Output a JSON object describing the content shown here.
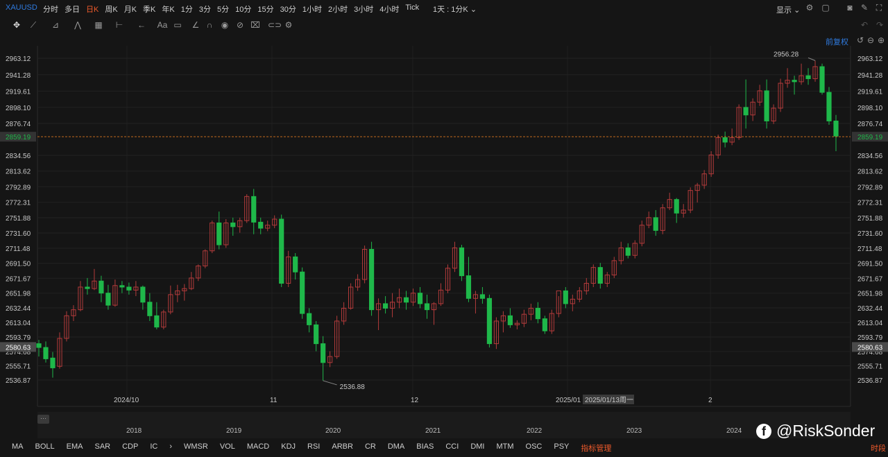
{
  "toolbar": {
    "symbol": "XAUUSD",
    "periods": [
      "分时",
      "多日",
      "日K",
      "周K",
      "月K",
      "季K",
      "年K",
      "1分",
      "3分",
      "5分",
      "10分",
      "15分",
      "30分",
      "1小时",
      "2小时",
      "3小时",
      "4小时",
      "Tick"
    ],
    "active_period": "日K",
    "timeframe_select": "1天 : 1分K",
    "display_label": "显示"
  },
  "adjust_label": "前复权",
  "chart_data": {
    "type": "candlestick",
    "y_ticks": [
      "2963.12",
      "2941.28",
      "2919.61",
      "2898.10",
      "2876.74",
      "2834.56",
      "2813.62",
      "2792.89",
      "2772.31",
      "2751.88",
      "2731.60",
      "2711.48",
      "2691.50",
      "2671.67",
      "2651.98",
      "2632.44",
      "2613.04",
      "2593.79",
      "2574.68",
      "2555.71",
      "2536.87"
    ],
    "ylim": [
      2527,
      2972
    ],
    "x_labels": [
      "2024/10",
      "11",
      "12",
      "2025/01",
      "2"
    ],
    "crosshair_date": "2025/01/13周一",
    "current_price": "2859.19",
    "left_marker_price": "2580.63",
    "high_label": "2956.28",
    "low_label": "2536.88",
    "candles": [
      [
        2585,
        2590,
        2568,
        2580
      ],
      [
        2580,
        2588,
        2560,
        2565
      ],
      [
        2566,
        2574,
        2540,
        2553
      ],
      [
        2555,
        2600,
        2552,
        2592
      ],
      [
        2592,
        2628,
        2588,
        2622
      ],
      [
        2622,
        2636,
        2615,
        2630
      ],
      [
        2630,
        2668,
        2628,
        2660
      ],
      [
        2660,
        2672,
        2650,
        2658
      ],
      [
        2658,
        2684,
        2656,
        2668
      ],
      [
        2668,
        2675,
        2640,
        2652
      ],
      [
        2652,
        2663,
        2630,
        2636
      ],
      [
        2636,
        2670,
        2634,
        2662
      ],
      [
        2662,
        2668,
        2652,
        2660
      ],
      [
        2660,
        2666,
        2650,
        2656
      ],
      [
        2656,
        2668,
        2648,
        2660
      ],
      [
        2660,
        2662,
        2630,
        2640
      ],
      [
        2640,
        2652,
        2615,
        2622
      ],
      [
        2622,
        2640,
        2604,
        2607
      ],
      [
        2607,
        2630,
        2604,
        2627
      ],
      [
        2627,
        2662,
        2624,
        2650
      ],
      [
        2650,
        2663,
        2640,
        2655
      ],
      [
        2655,
        2664,
        2642,
        2658
      ],
      [
        2658,
        2680,
        2656,
        2672
      ],
      [
        2672,
        2690,
        2668,
        2688
      ],
      [
        2688,
        2710,
        2685,
        2708
      ],
      [
        2708,
        2748,
        2705,
        2745
      ],
      [
        2745,
        2760,
        2710,
        2716
      ],
      [
        2716,
        2750,
        2712,
        2745
      ],
      [
        2745,
        2752,
        2728,
        2740
      ],
      [
        2740,
        2752,
        2732,
        2748
      ],
      [
        2748,
        2783,
        2745,
        2780
      ],
      [
        2780,
        2790,
        2730,
        2746
      ],
      [
        2746,
        2752,
        2730,
        2738
      ],
      [
        2738,
        2748,
        2734,
        2742
      ],
      [
        2742,
        2755,
        2738,
        2750
      ],
      [
        2750,
        2756,
        2660,
        2665
      ],
      [
        2665,
        2708,
        2660,
        2700
      ],
      [
        2700,
        2705,
        2670,
        2680
      ],
      [
        2680,
        2686,
        2618,
        2625
      ],
      [
        2625,
        2632,
        2600,
        2610
      ],
      [
        2610,
        2615,
        2575,
        2585
      ],
      [
        2585,
        2595,
        2536,
        2560
      ],
      [
        2560,
        2575,
        2554,
        2568
      ],
      [
        2568,
        2622,
        2565,
        2615
      ],
      [
        2615,
        2640,
        2610,
        2632
      ],
      [
        2632,
        2665,
        2630,
        2660
      ],
      [
        2660,
        2677,
        2655,
        2670
      ],
      [
        2670,
        2715,
        2665,
        2710
      ],
      [
        2710,
        2720,
        2622,
        2630
      ],
      [
        2630,
        2645,
        2603,
        2638
      ],
      [
        2638,
        2648,
        2625,
        2632
      ],
      [
        2632,
        2652,
        2620,
        2640
      ],
      [
        2640,
        2658,
        2632,
        2646
      ],
      [
        2646,
        2655,
        2630,
        2640
      ],
      [
        2640,
        2658,
        2635,
        2652
      ],
      [
        2652,
        2660,
        2632,
        2638
      ],
      [
        2638,
        2650,
        2618,
        2630
      ],
      [
        2630,
        2640,
        2610,
        2638
      ],
      [
        2638,
        2665,
        2635,
        2656
      ],
      [
        2656,
        2690,
        2652,
        2685
      ],
      [
        2685,
        2720,
        2680,
        2712
      ],
      [
        2712,
        2716,
        2668,
        2675
      ],
      [
        2675,
        2700,
        2640,
        2645
      ],
      [
        2645,
        2655,
        2625,
        2650
      ],
      [
        2650,
        2660,
        2638,
        2645
      ],
      [
        2645,
        2650,
        2580,
        2585
      ],
      [
        2585,
        2620,
        2578,
        2615
      ],
      [
        2615,
        2628,
        2600,
        2622
      ],
      [
        2622,
        2632,
        2606,
        2610
      ],
      [
        2610,
        2616,
        2604,
        2612
      ],
      [
        2612,
        2630,
        2607,
        2624
      ],
      [
        2624,
        2638,
        2616,
        2632
      ],
      [
        2632,
        2640,
        2612,
        2618
      ],
      [
        2618,
        2622,
        2598,
        2602
      ],
      [
        2602,
        2630,
        2598,
        2625
      ],
      [
        2625,
        2648,
        2620,
        2655
      ],
      [
        2655,
        2660,
        2632,
        2638
      ],
      [
        2638,
        2650,
        2628,
        2644
      ],
      [
        2644,
        2660,
        2640,
        2655
      ],
      [
        2655,
        2672,
        2650,
        2665
      ],
      [
        2665,
        2690,
        2660,
        2686
      ],
      [
        2686,
        2692,
        2658,
        2665
      ],
      [
        2665,
        2680,
        2660,
        2676
      ],
      [
        2676,
        2700,
        2672,
        2695
      ],
      [
        2695,
        2720,
        2690,
        2712
      ],
      [
        2712,
        2718,
        2698,
        2702
      ],
      [
        2702,
        2722,
        2698,
        2718
      ],
      [
        2718,
        2748,
        2714,
        2742
      ],
      [
        2742,
        2760,
        2738,
        2752
      ],
      [
        2752,
        2762,
        2728,
        2735
      ],
      [
        2735,
        2770,
        2730,
        2765
      ],
      [
        2765,
        2785,
        2762,
        2776
      ],
      [
        2776,
        2778,
        2745,
        2758
      ],
      [
        2758,
        2770,
        2752,
        2762
      ],
      [
        2762,
        2792,
        2758,
        2788
      ],
      [
        2788,
        2798,
        2772,
        2795
      ],
      [
        2795,
        2815,
        2790,
        2810
      ],
      [
        2810,
        2840,
        2806,
        2835
      ],
      [
        2835,
        2862,
        2830,
        2858
      ],
      [
        2858,
        2866,
        2845,
        2852
      ],
      [
        2852,
        2870,
        2848,
        2858
      ],
      [
        2858,
        2902,
        2855,
        2898
      ],
      [
        2898,
        2935,
        2870,
        2888
      ],
      [
        2888,
        2910,
        2880,
        2905
      ],
      [
        2905,
        2928,
        2900,
        2920
      ],
      [
        2920,
        2935,
        2870,
        2880
      ],
      [
        2880,
        2902,
        2876,
        2897
      ],
      [
        2897,
        2936,
        2892,
        2930
      ],
      [
        2930,
        2950,
        2924,
        2934
      ],
      [
        2934,
        2940,
        2915,
        2932
      ],
      [
        2932,
        2956,
        2928,
        2940
      ],
      [
        2940,
        2950,
        2928,
        2936
      ],
      [
        2936,
        2960,
        2932,
        2952
      ],
      [
        2952,
        2956,
        2915,
        2918
      ],
      [
        2918,
        2925,
        2875,
        2880
      ],
      [
        2880,
        2888,
        2840,
        2860
      ]
    ]
  },
  "overview_years": [
    "2018",
    "2019",
    "2020",
    "2021",
    "2022",
    "2023",
    "2024"
  ],
  "indicators": [
    "MA",
    "BOLL",
    "EMA",
    "SAR",
    "CDP",
    "IC",
    "WMSR",
    "VOL",
    "MACD",
    "KDJ",
    "RSI",
    "ARBR",
    "CR",
    "DMA",
    "BIAS",
    "CCI",
    "DMI",
    "MTM",
    "OSC",
    "PSY"
  ],
  "indicator_manager": "指标管理",
  "time_segment": "时段",
  "watermark": "@RiskSonder",
  "colors": {
    "up": "#b33b3b",
    "down": "#1fb84a",
    "accent": "#2f7be0",
    "active": "#f05a2b"
  }
}
